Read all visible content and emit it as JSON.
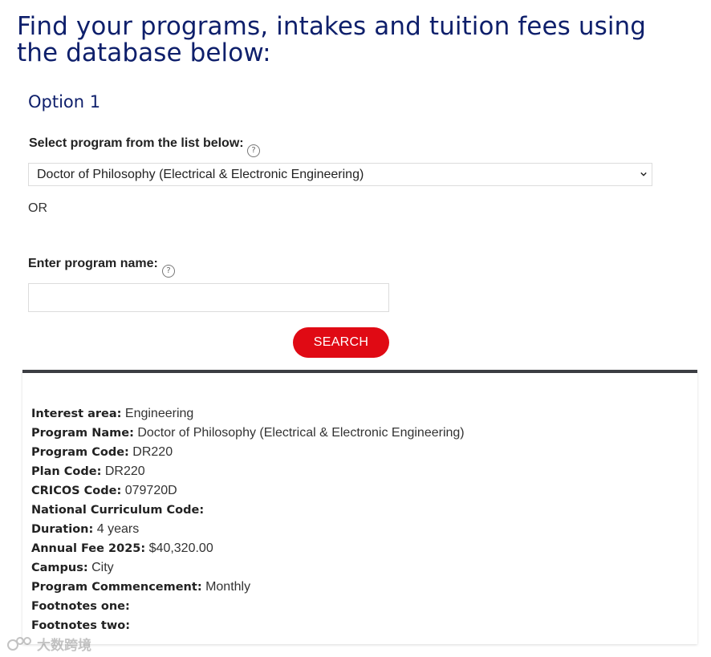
{
  "heading": "Find your programs, intakes and tuition fees using the database below:",
  "option_title": "Option 1",
  "select_program": {
    "label": "Select program from the list below:",
    "help_icon": "question-circle-icon",
    "selected": "Doctor of Philosophy (Electrical & Electronic Engineering)"
  },
  "or_text": "OR",
  "program_name": {
    "label": "Enter program name:",
    "help_icon": "question-circle-icon",
    "value": "",
    "placeholder": ""
  },
  "search_button": {
    "label": "SEARCH",
    "color": "#e00a14"
  },
  "results": {
    "border_color": "#3b3d42",
    "rows": [
      {
        "key": "Interest area:",
        "value": "Engineering"
      },
      {
        "key": "Program Name:",
        "value": "Doctor of Philosophy (Electrical & Electronic Engineering)"
      },
      {
        "key": "Program Code:",
        "value": "DR220"
      },
      {
        "key": "Plan Code:",
        "value": "DR220"
      },
      {
        "key": "CRICOS Code:",
        "value": "079720D"
      },
      {
        "key": "National Curriculum Code:",
        "value": ""
      },
      {
        "key": "Duration:",
        "value": "4 years"
      },
      {
        "key": "Annual Fee 2025:",
        "value": " $40,320.00"
      },
      {
        "key": "Campus:",
        "value": "City"
      },
      {
        "key": "Program Commencement:",
        "value": "Monthly"
      },
      {
        "key": "Footnotes one:",
        "value": ""
      },
      {
        "key": "Footnotes two:",
        "value": ""
      }
    ]
  },
  "watermark": {
    "text": "大数跨境",
    "icon": "watermark-logo-icon"
  },
  "colors": {
    "heading": "#0e1f6b",
    "accent": "#e00a14"
  }
}
